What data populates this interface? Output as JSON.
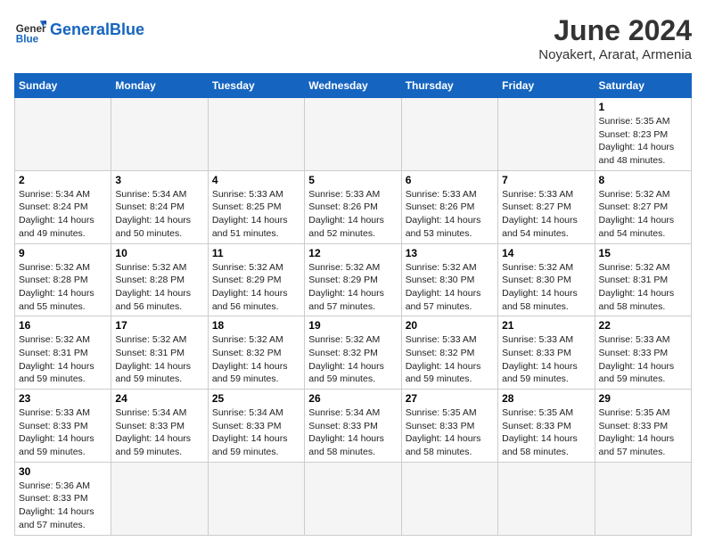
{
  "header": {
    "logo_general": "General",
    "logo_blue": "Blue",
    "title": "June 2024",
    "subtitle": "Noyakert, Ararat, Armenia"
  },
  "weekdays": [
    "Sunday",
    "Monday",
    "Tuesday",
    "Wednesday",
    "Thursday",
    "Friday",
    "Saturday"
  ],
  "weeks": [
    [
      {
        "day": "",
        "info": ""
      },
      {
        "day": "",
        "info": ""
      },
      {
        "day": "",
        "info": ""
      },
      {
        "day": "",
        "info": ""
      },
      {
        "day": "",
        "info": ""
      },
      {
        "day": "",
        "info": ""
      },
      {
        "day": "1",
        "info": "Sunrise: 5:35 AM\nSunset: 8:23 PM\nDaylight: 14 hours and 48 minutes."
      }
    ],
    [
      {
        "day": "2",
        "info": "Sunrise: 5:34 AM\nSunset: 8:24 PM\nDaylight: 14 hours and 49 minutes."
      },
      {
        "day": "3",
        "info": "Sunrise: 5:34 AM\nSunset: 8:24 PM\nDaylight: 14 hours and 50 minutes."
      },
      {
        "day": "4",
        "info": "Sunrise: 5:33 AM\nSunset: 8:25 PM\nDaylight: 14 hours and 51 minutes."
      },
      {
        "day": "5",
        "info": "Sunrise: 5:33 AM\nSunset: 8:26 PM\nDaylight: 14 hours and 52 minutes."
      },
      {
        "day": "6",
        "info": "Sunrise: 5:33 AM\nSunset: 8:26 PM\nDaylight: 14 hours and 53 minutes."
      },
      {
        "day": "7",
        "info": "Sunrise: 5:33 AM\nSunset: 8:27 PM\nDaylight: 14 hours and 54 minutes."
      },
      {
        "day": "8",
        "info": "Sunrise: 5:32 AM\nSunset: 8:27 PM\nDaylight: 14 hours and 54 minutes."
      }
    ],
    [
      {
        "day": "9",
        "info": "Sunrise: 5:32 AM\nSunset: 8:28 PM\nDaylight: 14 hours and 55 minutes."
      },
      {
        "day": "10",
        "info": "Sunrise: 5:32 AM\nSunset: 8:28 PM\nDaylight: 14 hours and 56 minutes."
      },
      {
        "day": "11",
        "info": "Sunrise: 5:32 AM\nSunset: 8:29 PM\nDaylight: 14 hours and 56 minutes."
      },
      {
        "day": "12",
        "info": "Sunrise: 5:32 AM\nSunset: 8:29 PM\nDaylight: 14 hours and 57 minutes."
      },
      {
        "day": "13",
        "info": "Sunrise: 5:32 AM\nSunset: 8:30 PM\nDaylight: 14 hours and 57 minutes."
      },
      {
        "day": "14",
        "info": "Sunrise: 5:32 AM\nSunset: 8:30 PM\nDaylight: 14 hours and 58 minutes."
      },
      {
        "day": "15",
        "info": "Sunrise: 5:32 AM\nSunset: 8:31 PM\nDaylight: 14 hours and 58 minutes."
      }
    ],
    [
      {
        "day": "16",
        "info": "Sunrise: 5:32 AM\nSunset: 8:31 PM\nDaylight: 14 hours and 59 minutes."
      },
      {
        "day": "17",
        "info": "Sunrise: 5:32 AM\nSunset: 8:31 PM\nDaylight: 14 hours and 59 minutes."
      },
      {
        "day": "18",
        "info": "Sunrise: 5:32 AM\nSunset: 8:32 PM\nDaylight: 14 hours and 59 minutes."
      },
      {
        "day": "19",
        "info": "Sunrise: 5:32 AM\nSunset: 8:32 PM\nDaylight: 14 hours and 59 minutes."
      },
      {
        "day": "20",
        "info": "Sunrise: 5:33 AM\nSunset: 8:32 PM\nDaylight: 14 hours and 59 minutes."
      },
      {
        "day": "21",
        "info": "Sunrise: 5:33 AM\nSunset: 8:33 PM\nDaylight: 14 hours and 59 minutes."
      },
      {
        "day": "22",
        "info": "Sunrise: 5:33 AM\nSunset: 8:33 PM\nDaylight: 14 hours and 59 minutes."
      }
    ],
    [
      {
        "day": "23",
        "info": "Sunrise: 5:33 AM\nSunset: 8:33 PM\nDaylight: 14 hours and 59 minutes."
      },
      {
        "day": "24",
        "info": "Sunrise: 5:34 AM\nSunset: 8:33 PM\nDaylight: 14 hours and 59 minutes."
      },
      {
        "day": "25",
        "info": "Sunrise: 5:34 AM\nSunset: 8:33 PM\nDaylight: 14 hours and 59 minutes."
      },
      {
        "day": "26",
        "info": "Sunrise: 5:34 AM\nSunset: 8:33 PM\nDaylight: 14 hours and 58 minutes."
      },
      {
        "day": "27",
        "info": "Sunrise: 5:35 AM\nSunset: 8:33 PM\nDaylight: 14 hours and 58 minutes."
      },
      {
        "day": "28",
        "info": "Sunrise: 5:35 AM\nSunset: 8:33 PM\nDaylight: 14 hours and 58 minutes."
      },
      {
        "day": "29",
        "info": "Sunrise: 5:35 AM\nSunset: 8:33 PM\nDaylight: 14 hours and 57 minutes."
      }
    ],
    [
      {
        "day": "30",
        "info": "Sunrise: 5:36 AM\nSunset: 8:33 PM\nDaylight: 14 hours and 57 minutes."
      },
      {
        "day": "",
        "info": ""
      },
      {
        "day": "",
        "info": ""
      },
      {
        "day": "",
        "info": ""
      },
      {
        "day": "",
        "info": ""
      },
      {
        "day": "",
        "info": ""
      },
      {
        "day": "",
        "info": ""
      }
    ]
  ]
}
